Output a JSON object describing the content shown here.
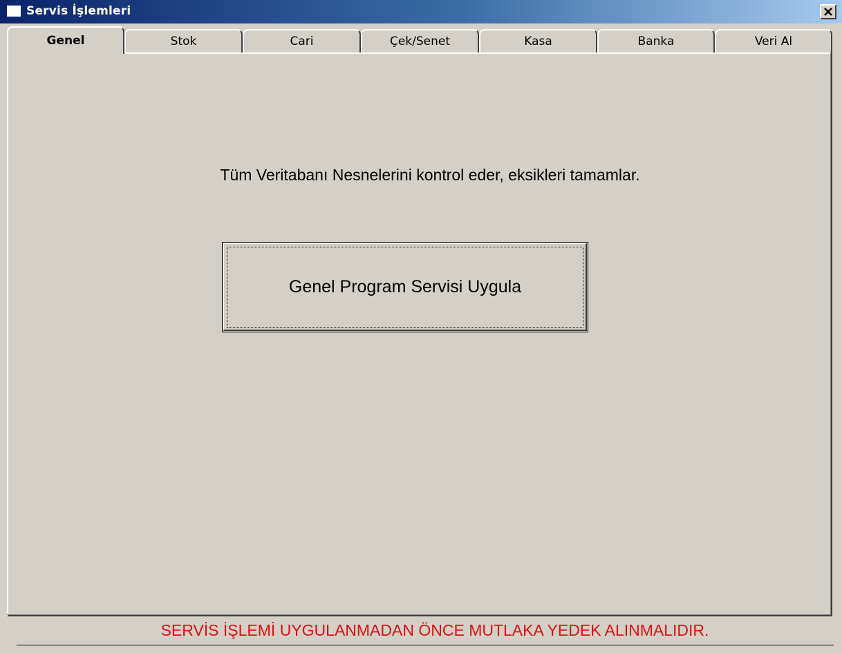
{
  "window": {
    "title": "Servis İşlemleri",
    "close_symbol": "close-icon"
  },
  "tabs": [
    {
      "label": "Genel",
      "active": true
    },
    {
      "label": "Stok",
      "active": false
    },
    {
      "label": "Cari",
      "active": false
    },
    {
      "label": "Çek/Senet",
      "active": false
    },
    {
      "label": "Kasa",
      "active": false
    },
    {
      "label": "Banka",
      "active": false
    },
    {
      "label": "Veri Al",
      "active": false
    }
  ],
  "main": {
    "description": "Tüm Veritabanı Nesnelerini kontrol eder, eksikleri tamamlar.",
    "apply_button_label": "Genel Program Servisi Uygula"
  },
  "footer": {
    "warning": "SERVİS İŞLEMİ UYGULANMADAN ÖNCE MUTLAKA YEDEK ALINMALIDIR."
  },
  "colors": {
    "face": "#d4d0c8",
    "title_start": "#0a246a",
    "title_end": "#a6caf0",
    "warning": "#e01010"
  }
}
